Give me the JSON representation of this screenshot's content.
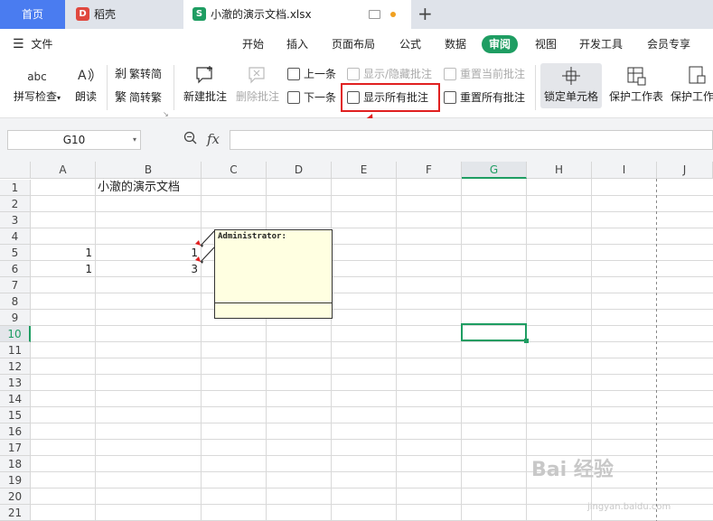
{
  "tabs": {
    "home": "首页",
    "daoke": "稻壳",
    "daoke_logo": "D",
    "document": "小澈的演示文档.xlsx",
    "doc_logo": "S",
    "new_tab": "+"
  },
  "menu": {
    "file": "文件",
    "items": [
      "开始",
      "插入",
      "页面布局",
      "公式",
      "数据",
      "审阅",
      "视图",
      "开发工具",
      "会员专享"
    ],
    "active": "审阅"
  },
  "ribbon": {
    "spell_check": "拼写检查",
    "spell_icon_text": "abc",
    "read_aloud": "朗读",
    "trad_to_simp": "繁转简",
    "simp_to_trad": "简转繁",
    "new_comment": "新建批注",
    "delete_comment": "删除批注",
    "prev": "上一条",
    "next": "下一条",
    "show_hide_comment": "显示/隐藏批注",
    "show_all_comments": "显示所有批注",
    "reset_current_comment": "重置当前批注",
    "reset_all_comments": "重置所有批注",
    "lock_cell": "锁定单元格",
    "protect_sheet": "保护工作表",
    "protect_workbook": "保护工作"
  },
  "formula_bar": {
    "cell_ref": "G10",
    "fx": "fx",
    "value": ""
  },
  "grid": {
    "columns": [
      "A",
      "B",
      "C",
      "D",
      "E",
      "F",
      "G",
      "H",
      "I",
      "J"
    ],
    "rows": [
      "1",
      "2",
      "3",
      "4",
      "5",
      "6",
      "7",
      "8",
      "9",
      "10",
      "11",
      "12",
      "13",
      "14",
      "15",
      "16",
      "17",
      "18",
      "19",
      "20",
      "21"
    ],
    "b1": "小澈的演示文档",
    "a5": "1",
    "b5": "1",
    "a6": "1",
    "b6": "3",
    "selected_column": "G",
    "selected_row": "10"
  },
  "comment": {
    "author": "Administrator:"
  },
  "watermark": {
    "main": "Bai 经验",
    "sub": "jingyan.baidu.com"
  },
  "colors": {
    "accent_green": "#1e9d62",
    "home_tab_blue": "#4a7cf0",
    "highlight_red": "#e02020",
    "comment_bg": "#ffffe1"
  }
}
